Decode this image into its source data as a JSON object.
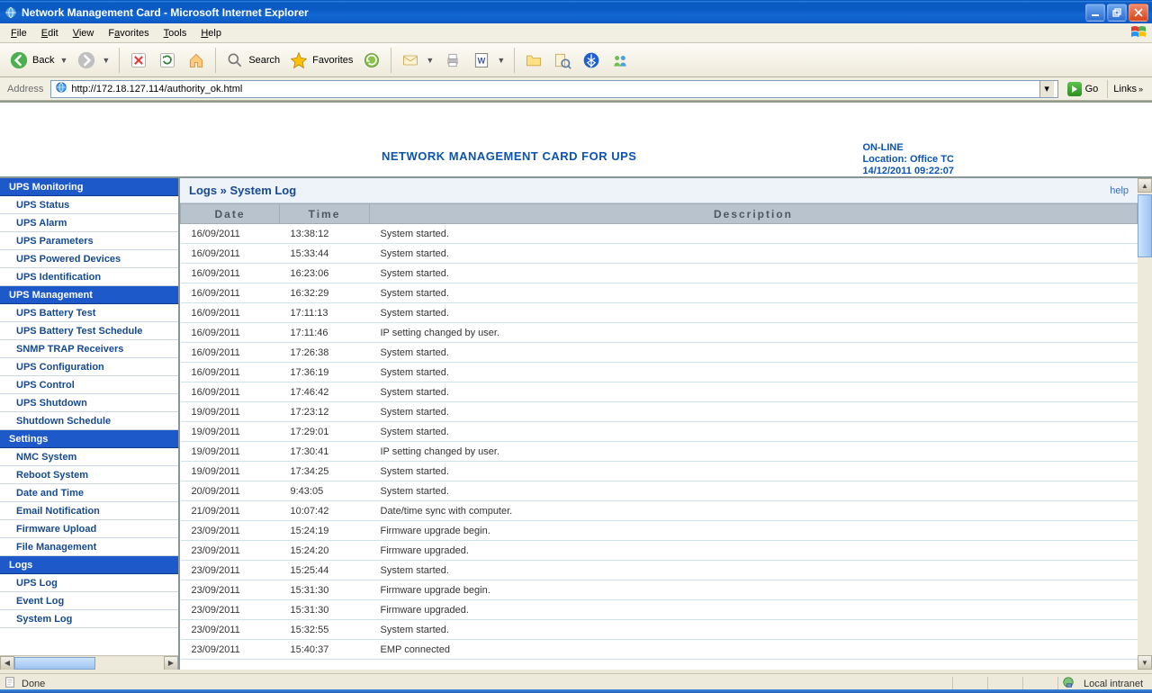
{
  "window": {
    "title": "Network Management Card - Microsoft Internet Explorer"
  },
  "menu": {
    "file": "File",
    "edit": "Edit",
    "view": "View",
    "favorites": "Favorites",
    "tools": "Tools",
    "help": "Help"
  },
  "toolbar": {
    "back": "Back",
    "search": "Search",
    "favorites": "Favorites"
  },
  "address": {
    "label": "Address",
    "url": "http://172.18.127.114/authority_ok.html",
    "go": "Go",
    "links": "Links"
  },
  "header": {
    "title": "NETWORK MANAGEMENT CARD FOR UPS",
    "status1": "ON-LINE",
    "status2": "Location: Office TC",
    "status3": "14/12/2011 09:22:07"
  },
  "sidebar": {
    "sections": [
      {
        "type": "header",
        "label": "UPS Monitoring"
      },
      {
        "type": "item",
        "label": "UPS Status"
      },
      {
        "type": "item",
        "label": "UPS Alarm"
      },
      {
        "type": "item",
        "label": "UPS Parameters"
      },
      {
        "type": "item",
        "label": "UPS Powered Devices"
      },
      {
        "type": "item",
        "label": "UPS Identification"
      },
      {
        "type": "header",
        "label": "UPS Management"
      },
      {
        "type": "item",
        "label": "UPS Battery Test"
      },
      {
        "type": "item",
        "label": "UPS Battery Test Schedule"
      },
      {
        "type": "item",
        "label": "SNMP TRAP Receivers"
      },
      {
        "type": "item",
        "label": "UPS Configuration"
      },
      {
        "type": "item",
        "label": "UPS Control"
      },
      {
        "type": "item",
        "label": "UPS Shutdown"
      },
      {
        "type": "item",
        "label": "Shutdown Schedule"
      },
      {
        "type": "header",
        "label": "Settings"
      },
      {
        "type": "item",
        "label": "NMC System"
      },
      {
        "type": "item",
        "label": "Reboot System"
      },
      {
        "type": "item",
        "label": "Date and Time"
      },
      {
        "type": "item",
        "label": "Email Notification"
      },
      {
        "type": "item",
        "label": "Firmware Upload"
      },
      {
        "type": "item",
        "label": "File Management"
      },
      {
        "type": "header",
        "label": "Logs"
      },
      {
        "type": "item",
        "label": "UPS Log"
      },
      {
        "type": "item",
        "label": "Event Log"
      },
      {
        "type": "item",
        "label": "System Log"
      }
    ]
  },
  "main": {
    "breadcrumb": "Logs » System Log",
    "help": "help",
    "columns": {
      "date": "Date",
      "time": "Time",
      "description": "Description"
    },
    "rows": [
      {
        "date": "16/09/2011",
        "time": "13:38:12",
        "desc": "System started."
      },
      {
        "date": "16/09/2011",
        "time": "15:33:44",
        "desc": "System started."
      },
      {
        "date": "16/09/2011",
        "time": "16:23:06",
        "desc": "System started."
      },
      {
        "date": "16/09/2011",
        "time": "16:32:29",
        "desc": "System started."
      },
      {
        "date": "16/09/2011",
        "time": "17:11:13",
        "desc": "System started."
      },
      {
        "date": "16/09/2011",
        "time": "17:11:46",
        "desc": "IP setting changed by user."
      },
      {
        "date": "16/09/2011",
        "time": "17:26:38",
        "desc": "System started."
      },
      {
        "date": "16/09/2011",
        "time": "17:36:19",
        "desc": "System started."
      },
      {
        "date": "16/09/2011",
        "time": "17:46:42",
        "desc": "System started."
      },
      {
        "date": "19/09/2011",
        "time": "17:23:12",
        "desc": "System started."
      },
      {
        "date": "19/09/2011",
        "time": "17:29:01",
        "desc": "System started."
      },
      {
        "date": "19/09/2011",
        "time": "17:30:41",
        "desc": "IP setting changed by user."
      },
      {
        "date": "19/09/2011",
        "time": "17:34:25",
        "desc": "System started."
      },
      {
        "date": "20/09/2011",
        "time": "9:43:05",
        "desc": "System started."
      },
      {
        "date": "21/09/2011",
        "time": "10:07:42",
        "desc": "Date/time sync with computer."
      },
      {
        "date": "23/09/2011",
        "time": "15:24:19",
        "desc": "Firmware upgrade begin."
      },
      {
        "date": "23/09/2011",
        "time": "15:24:20",
        "desc": "Firmware upgraded."
      },
      {
        "date": "23/09/2011",
        "time": "15:25:44",
        "desc": "System started."
      },
      {
        "date": "23/09/2011",
        "time": "15:31:30",
        "desc": "Firmware upgrade begin."
      },
      {
        "date": "23/09/2011",
        "time": "15:31:30",
        "desc": "Firmware upgraded."
      },
      {
        "date": "23/09/2011",
        "time": "15:32:55",
        "desc": "System started."
      },
      {
        "date": "23/09/2011",
        "time": "15:40:37",
        "desc": "EMP connected"
      }
    ]
  },
  "status": {
    "done": "Done",
    "zone": "Local intranet"
  }
}
